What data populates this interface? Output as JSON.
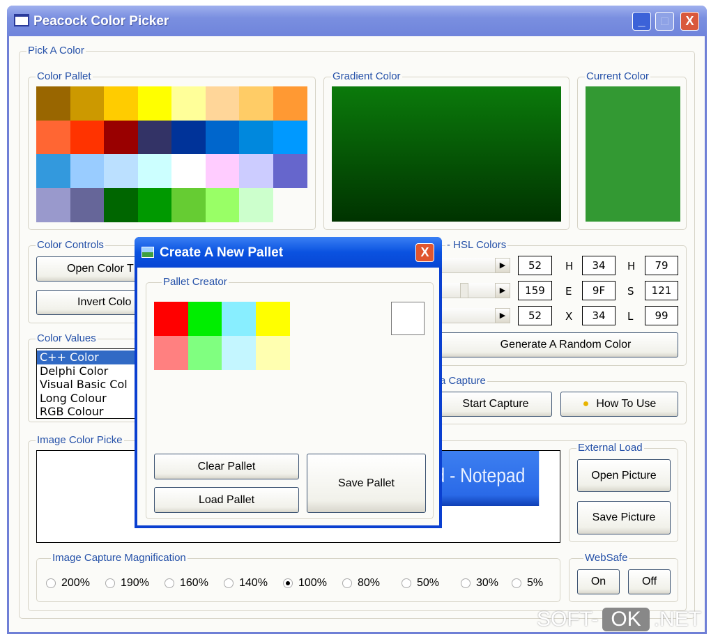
{
  "window": {
    "title": "Peacock Color Picker",
    "minimize": "_",
    "maximize": "□",
    "close": "X"
  },
  "pick_group": "Pick A Color",
  "color_pallet": {
    "label": "Color Pallet",
    "colors": [
      [
        "#996600",
        "#cc9900",
        "#ffcc00",
        "#ffff00",
        "#ffff99",
        "#ffd699",
        "#ffcc66",
        "#ff9933"
      ],
      [
        "#ff6633",
        "#ff3300",
        "#990000",
        "#333366",
        "#003399",
        "#0066cc",
        "#0088dd",
        "#0099ff"
      ],
      [
        "#3399dd",
        "#99ccff",
        "#bbe0ff",
        "#ccffff",
        "#ffffff",
        "#ffccff",
        "#ccccff",
        "#6666cc"
      ],
      [
        "#9999cc",
        "#666699",
        "#006600",
        "#009900",
        "#66cc33",
        "#99ff66",
        "#ccffcc",
        null
      ]
    ]
  },
  "gradient": {
    "label": "Gradient Color",
    "top": "#0b7a0b",
    "bottom": "#003300"
  },
  "current": {
    "label": "Current Color",
    "color": "#339933"
  },
  "controls": {
    "label": "Color Controls",
    "open": "Open Color T",
    "invert": "Invert Colo"
  },
  "hsl": {
    "label": "- HSL Colors",
    "rows": [
      {
        "rgb": "52",
        "hex_label": "H",
        "hex": "34",
        "hsl_label": "H",
        "hsl": "79"
      },
      {
        "rgb": "159",
        "hex_label": "E",
        "hex": "9F",
        "hsl_label": "S",
        "hsl": "121"
      },
      {
        "rgb": "52",
        "hex_label": "X",
        "hex": "34",
        "hsl_label": "L",
        "hsl": "99"
      }
    ],
    "random": "Generate A Random Color"
  },
  "capture": {
    "label": "a Capture",
    "start": "Start Capture",
    "how": "How To Use"
  },
  "values": {
    "label": "Color Values",
    "items": [
      "C++ Color",
      "Delphi Color",
      "Visual Basic Col",
      "Long Colour",
      "RGB Colour"
    ],
    "selected": 0
  },
  "image_picker": {
    "label": "Image Color Picke",
    "preview_text": "itled - Notepad"
  },
  "external": {
    "label": "External Load",
    "open": "Open Picture",
    "save": "Save Picture"
  },
  "magnification": {
    "label": "Image Capture Magnification",
    "options": [
      "200%",
      "190%",
      "160%",
      "140%",
      "100%",
      "80%",
      "50%",
      "30%",
      "5%"
    ],
    "selected": "100%"
  },
  "websafe": {
    "label": "WebSafe",
    "on": "On",
    "off": "Off"
  },
  "dialog": {
    "title": "Create A New Pallet",
    "group": "Pallet Creator",
    "swatches": [
      "#ff0000",
      "#00ee00",
      "#88eeff",
      "#ffff00",
      "#ff8080",
      "#80ff80",
      "#c4f6ff",
      "#ffffb0"
    ],
    "clear": "Clear Pallet",
    "load": "Load Pallet",
    "save": "Save Pallet"
  },
  "watermark": {
    "a": "SOFT-",
    "b": "OK",
    ".c": "",
    "c": ".NET"
  }
}
